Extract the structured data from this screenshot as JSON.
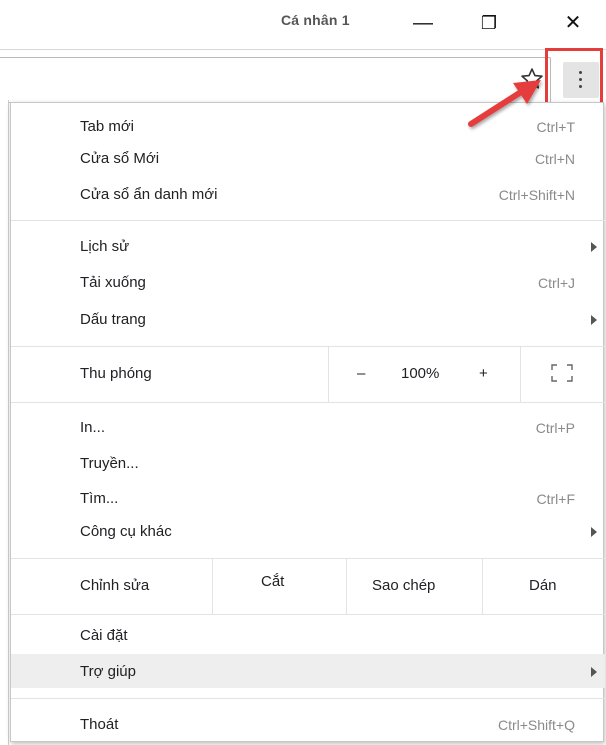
{
  "window": {
    "profile_name": "Cá nhân 1",
    "minimize_glyph": "—",
    "restore_glyph": "❐",
    "close_glyph": "✕"
  },
  "toolbar": {
    "bookmark_icon": "star-outline",
    "menu_icon": "three-dots-vertical"
  },
  "menu": {
    "new_tab": {
      "label": "Tab mới",
      "shortcut": "Ctrl+T"
    },
    "new_window": {
      "label": "Cửa sổ Mới",
      "shortcut": "Ctrl+N"
    },
    "incognito": {
      "label": "Cửa sổ ẩn danh mới",
      "shortcut": "Ctrl+Shift+N"
    },
    "history": {
      "label": "Lịch sử"
    },
    "downloads": {
      "label": "Tải xuống",
      "shortcut": "Ctrl+J"
    },
    "bookmarks": {
      "label": "Dấu trang"
    },
    "zoom": {
      "label": "Thu phóng",
      "minus": "–",
      "value": "100%",
      "plus": "+"
    },
    "print": {
      "label": "In...",
      "shortcut": "Ctrl+P"
    },
    "cast": {
      "label": "Truyền..."
    },
    "find": {
      "label": "Tìm...",
      "shortcut": "Ctrl+F"
    },
    "more_tools": {
      "label": "Công cụ khác"
    },
    "edit": {
      "label": "Chỉnh sửa",
      "cut": "Cắt",
      "copy": "Sao chép",
      "paste": "Dán"
    },
    "settings": {
      "label": "Cài đặt"
    },
    "help": {
      "label": "Trợ giúp"
    },
    "exit": {
      "label": "Thoát",
      "shortcut": "Ctrl+Shift+Q"
    }
  },
  "colors": {
    "annotation": "#e53c3c",
    "hover_bg": "#eeeeee"
  }
}
